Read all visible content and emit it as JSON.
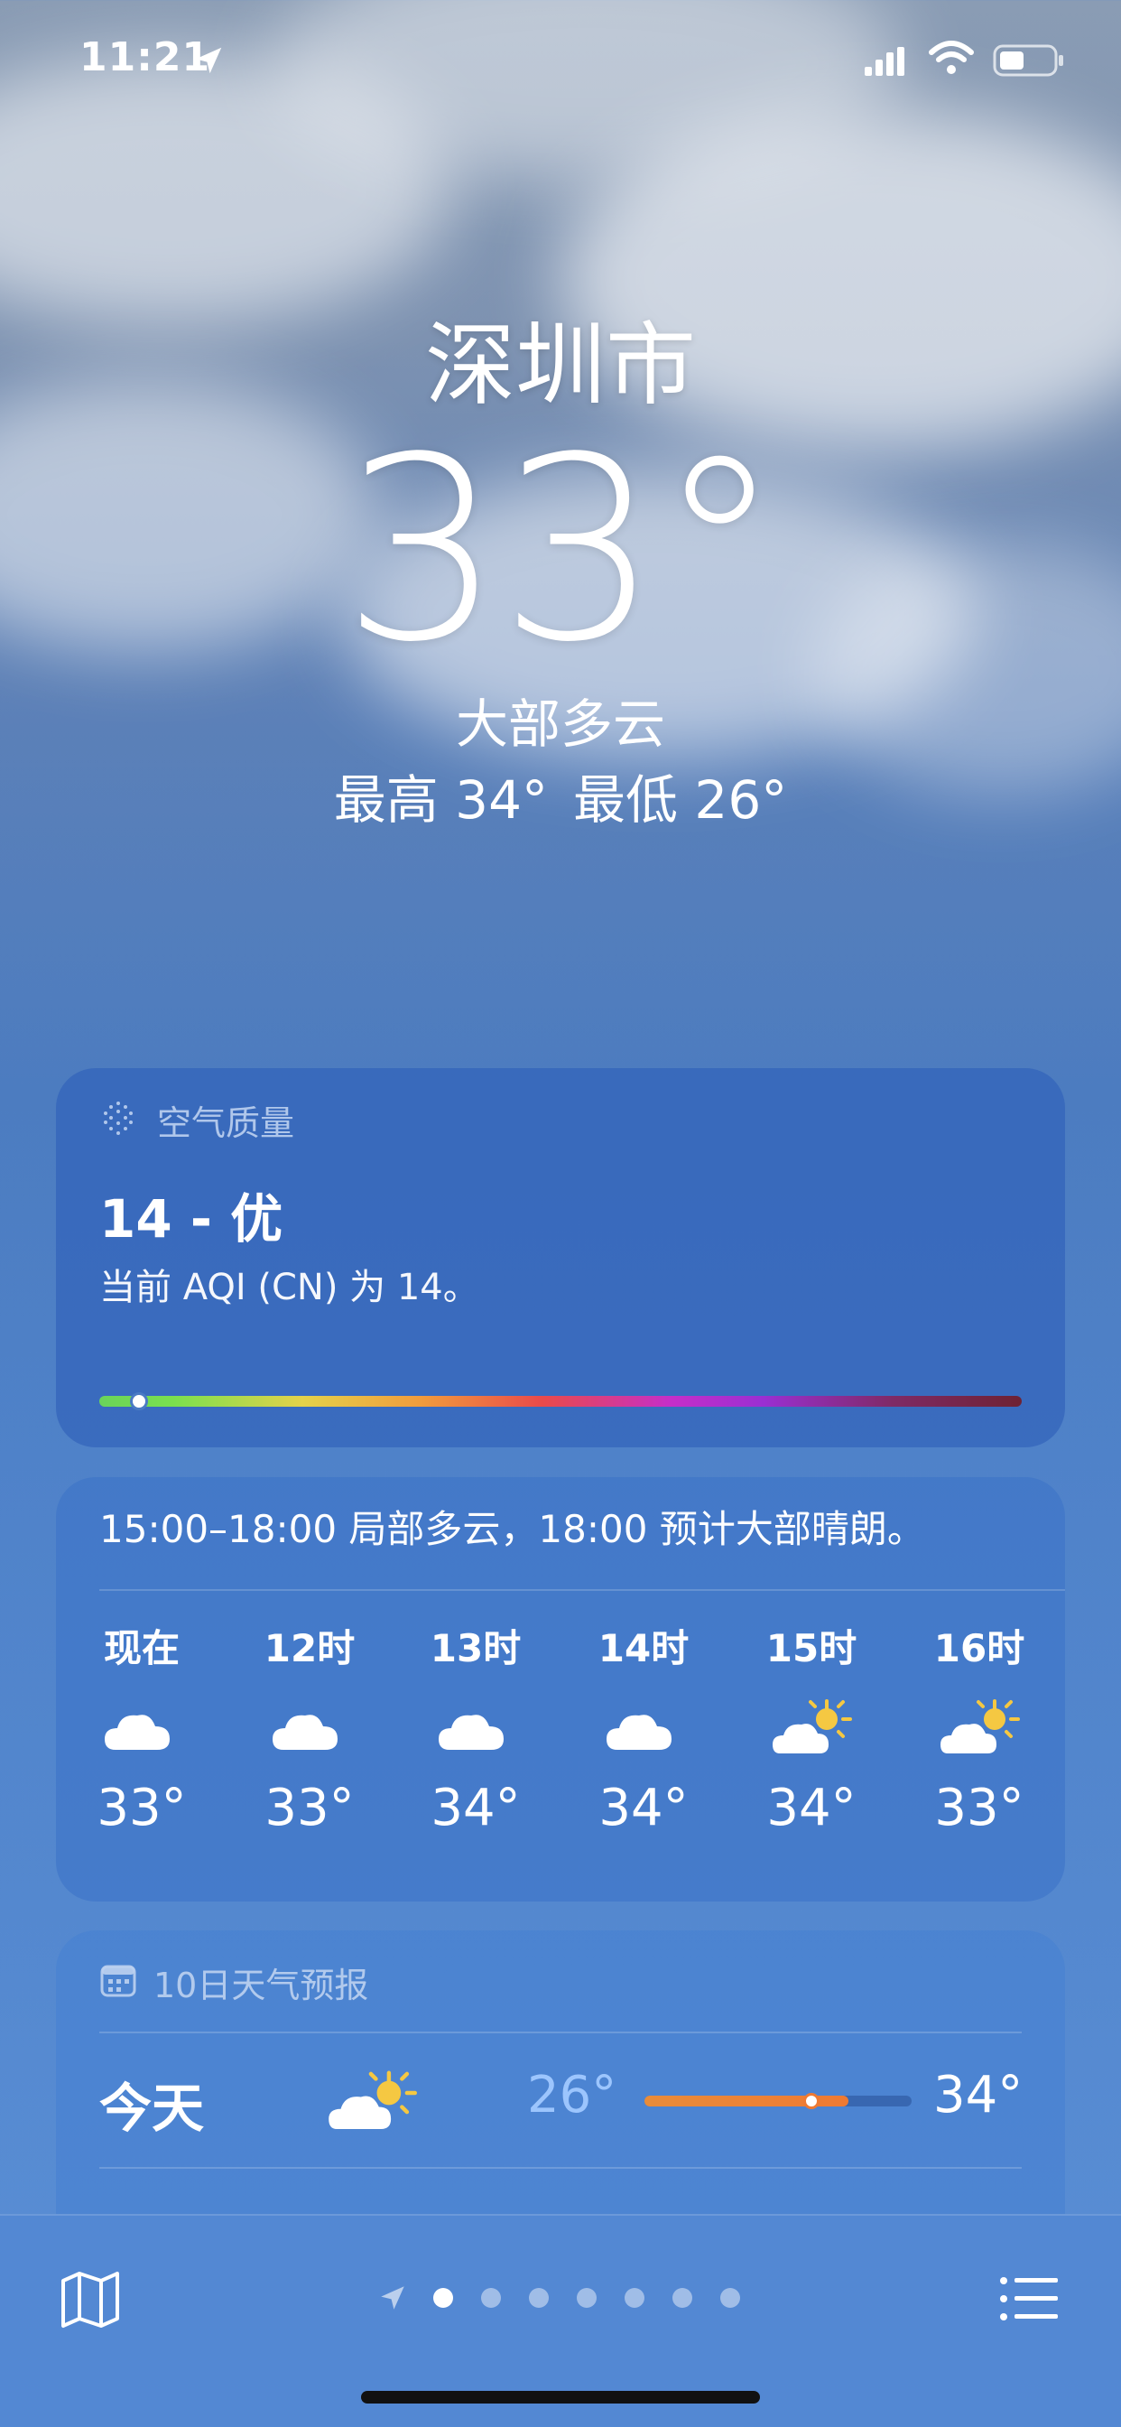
{
  "status": {
    "time": "11:21",
    "icons": [
      "location-arrow-icon",
      "signal-icon",
      "wifi-icon",
      "battery-icon"
    ]
  },
  "current": {
    "city": "深圳市",
    "temperature": "33°",
    "condition": "大部多云",
    "high": "最高 34°",
    "low": "最低 26°"
  },
  "air_quality": {
    "label": "空气质量",
    "value": "14 - 优",
    "description": "当前 AQI (CN) 为 14。",
    "aqi_scale_position": 0.03
  },
  "hourly": {
    "summary": "15:00–18:00 局部多云，18:00 预计大部晴朗。",
    "hours": [
      {
        "label": "现在",
        "icon": "cloud-icon",
        "temp": "33°"
      },
      {
        "label": "12时",
        "icon": "cloud-icon",
        "temp": "33°"
      },
      {
        "label": "13时",
        "icon": "cloud-icon",
        "temp": "34°"
      },
      {
        "label": "14时",
        "icon": "cloud-icon",
        "temp": "34°"
      },
      {
        "label": "15时",
        "icon": "partly-sunny-icon",
        "temp": "34°"
      },
      {
        "label": "16时",
        "icon": "partly-sunny-icon",
        "temp": "33°"
      }
    ]
  },
  "daily": {
    "label": "10日天气预报",
    "days": [
      {
        "name": "今天",
        "icon": "partly-sunny-icon",
        "low": "26°",
        "high": "34°"
      }
    ]
  },
  "bottom_bar": {
    "pages": 7,
    "active_page": 0,
    "icons": [
      "map-icon",
      "location-arrow-icon",
      "list-icon"
    ]
  },
  "colors": {
    "accent_orange": "#ee7a33",
    "sun_yellow": "#f5c842",
    "card_blue": "#3062b9"
  }
}
